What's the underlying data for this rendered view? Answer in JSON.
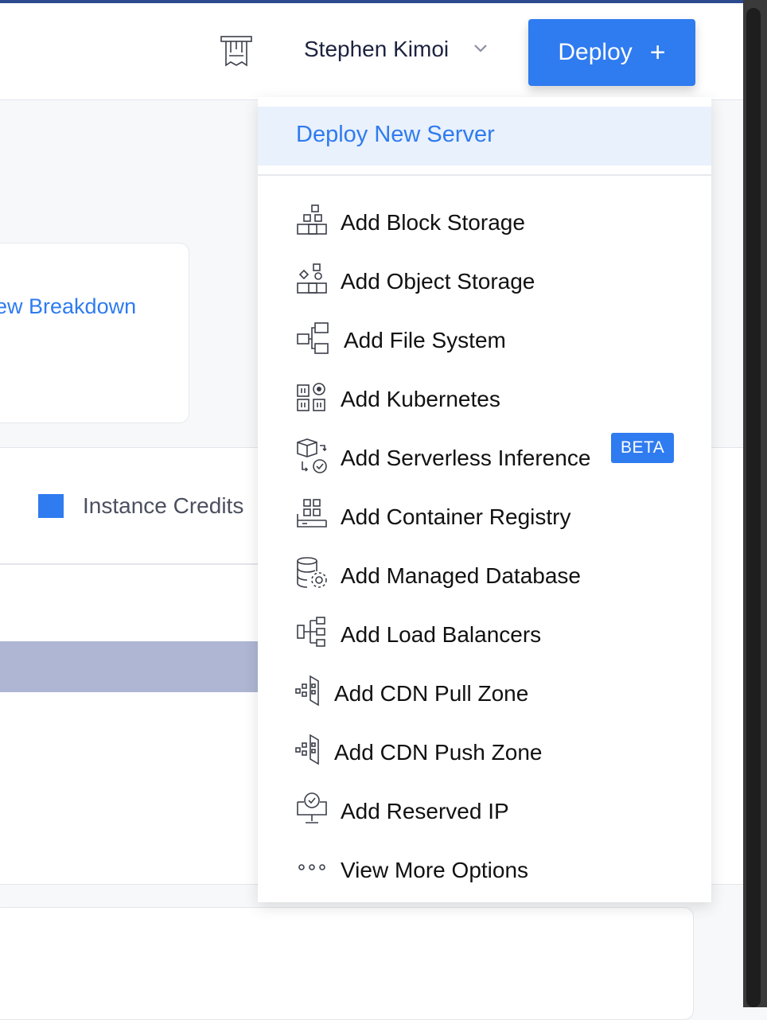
{
  "header": {
    "user_name": "Stephen Kimoi",
    "deploy_label": "Deploy",
    "deploy_plus": "+"
  },
  "background": {
    "breakdown_link": "ew Breakdown",
    "legend_label": "Instance Credits",
    "legend_color": "#2f7bf0"
  },
  "dropdown": {
    "highlight_label": "Deploy New Server",
    "items": [
      {
        "label": "Add Block Storage",
        "icon": "block-storage-icon"
      },
      {
        "label": "Add Object Storage",
        "icon": "object-storage-icon"
      },
      {
        "label": "Add File System",
        "icon": "file-system-icon"
      },
      {
        "label": "Add Kubernetes",
        "icon": "kubernetes-icon"
      },
      {
        "label": "Add Serverless Inference",
        "icon": "serverless-inference-icon",
        "badge": "BETA"
      },
      {
        "label": "Add Container Registry",
        "icon": "container-registry-icon"
      },
      {
        "label": "Add Managed Database",
        "icon": "managed-database-icon"
      },
      {
        "label": "Add Load Balancers",
        "icon": "load-balancer-icon"
      },
      {
        "label": "Add CDN Pull Zone",
        "icon": "cdn-pull-zone-icon"
      },
      {
        "label": "Add CDN Push Zone",
        "icon": "cdn-push-zone-icon"
      },
      {
        "label": "Add Reserved IP",
        "icon": "reserved-ip-icon"
      },
      {
        "label": "View More Options",
        "icon": "more-options-icon"
      }
    ]
  },
  "colors": {
    "accent": "#2f7bf0",
    "highlight_bg": "#e9f1fc"
  }
}
